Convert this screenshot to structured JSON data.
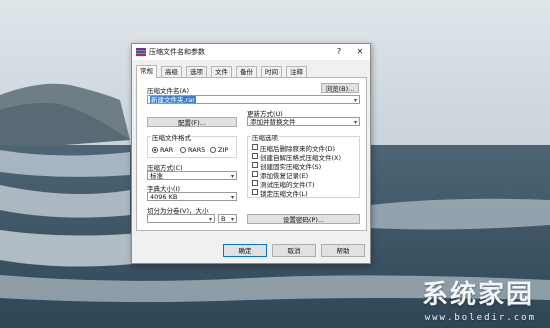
{
  "watermark": {
    "brand": "系统家园",
    "url": "www.boledir.com"
  },
  "dialog": {
    "title": "压缩文件名和参数",
    "help_symbol": "?",
    "close_symbol": "✕",
    "tabs": [
      {
        "label": "常规",
        "active": true
      },
      {
        "label": "高级",
        "active": false
      },
      {
        "label": "选项",
        "active": false
      },
      {
        "label": "文件",
        "active": false
      },
      {
        "label": "备份",
        "active": false
      },
      {
        "label": "时间",
        "active": false
      },
      {
        "label": "注释",
        "active": false
      }
    ],
    "archive_name": {
      "label": "压缩文件名(A)",
      "value": "新建文件夹.rar",
      "browse_label": "浏览(B)..."
    },
    "config_label": "配置(F)...",
    "update_mode": {
      "label": "更新方式(U)",
      "value": "添加并替换文件"
    },
    "archive_format": {
      "title": "压缩文件格式",
      "options": [
        {
          "label": "RAR",
          "selected": true
        },
        {
          "label": "RAR5",
          "selected": false
        },
        {
          "label": "ZIP",
          "selected": false
        }
      ]
    },
    "compression_method": {
      "label": "压缩方式(C)",
      "value": "标准"
    },
    "dictionary_size": {
      "label": "字典大小(I)",
      "value": "4096 KB"
    },
    "split_volume": {
      "label": "切分为分卷(V)，大小",
      "value": "",
      "unit": "B"
    },
    "archive_options": {
      "title": "压缩选项",
      "items": [
        {
          "label": "压缩后删除原来的文件(D)",
          "checked": false
        },
        {
          "label": "创建自解压格式压缩文件(X)",
          "checked": false
        },
        {
          "label": "创建固实压缩文件(S)",
          "checked": false
        },
        {
          "label": "添加恢复记录(E)",
          "checked": false
        },
        {
          "label": "测试压缩的文件(T)",
          "checked": false
        },
        {
          "label": "锁定压缩文件(L)",
          "checked": false
        }
      ]
    },
    "set_password_label": "设置密码(P)...",
    "buttons": {
      "ok": "确定",
      "cancel": "取消",
      "help": "帮助"
    }
  }
}
